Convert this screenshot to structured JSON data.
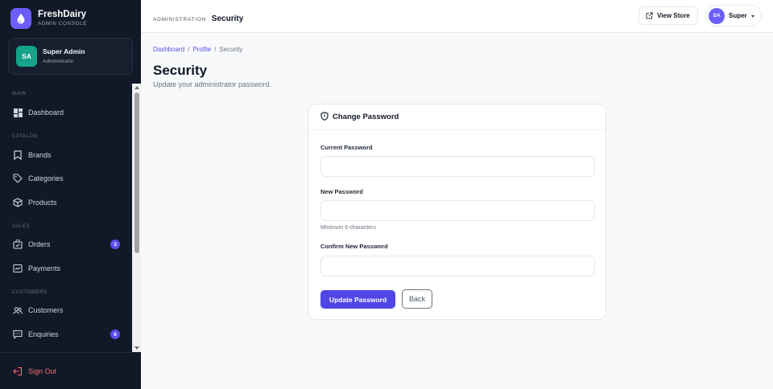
{
  "brand": {
    "name": "FreshDairy",
    "subtitle": "ADMIN CONSOLE"
  },
  "user_card": {
    "initials": "SA",
    "name": "Super Admin",
    "role": "Administrator"
  },
  "sidebar": {
    "sections": [
      {
        "label": "MAIN"
      },
      {
        "label": "CATALOG"
      },
      {
        "label": "SALES"
      },
      {
        "label": "CUSTOMERS"
      }
    ],
    "items": [
      {
        "label": "Dashboard",
        "icon": "grid-icon"
      },
      {
        "label": "Brands",
        "icon": "bookmark-icon"
      },
      {
        "label": "Categories",
        "icon": "tag-icon"
      },
      {
        "label": "Products",
        "icon": "box-icon"
      },
      {
        "label": "Orders",
        "icon": "bag-check-icon",
        "badge": "3"
      },
      {
        "label": "Payments",
        "icon": "receipt-icon"
      },
      {
        "label": "Customers",
        "icon": "people-icon"
      },
      {
        "label": "Enquiries",
        "icon": "chat-icon",
        "badge": "6"
      }
    ],
    "sign_out": "Sign Out"
  },
  "topbar": {
    "kicker": "ADMINISTRATION",
    "title": "Security",
    "view_store": "View Store",
    "account_initials": "SA",
    "account_name": "Super"
  },
  "breadcrumb": {
    "items": [
      "Dashboard",
      "Profile"
    ],
    "current": "Security",
    "separator": "/"
  },
  "page": {
    "title": "Security",
    "subtitle": "Update your administrator password."
  },
  "form": {
    "title": "Change Password",
    "current_label": "Current Password",
    "current_value": "",
    "new_label": "New Password",
    "new_value": "",
    "new_help": "Minimum 6 characters",
    "confirm_label": "Confirm New Password",
    "confirm_value": "",
    "submit": "Update Password",
    "back": "Back"
  },
  "colors": {
    "sidebar_bg": "#111827",
    "accent": "#4f46e5",
    "badge": "#5b4ee8",
    "user_avatar": "#14a38b",
    "sign_out": "#f87171"
  }
}
